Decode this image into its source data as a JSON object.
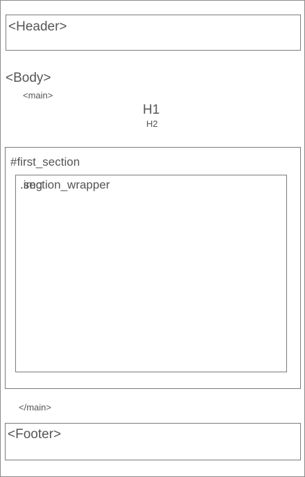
{
  "header": {
    "label": "<Header>"
  },
  "body": {
    "label": "<Body>",
    "main_open": "<main>",
    "h1": "H1",
    "h2": "H2",
    "first_section": {
      "label": "#first_section",
      "section_wrapper": {
        "label": ".section_wrapper",
        "img": ".img"
      }
    },
    "main_close": "</main>"
  },
  "footer": {
    "label": "<Footer>"
  }
}
